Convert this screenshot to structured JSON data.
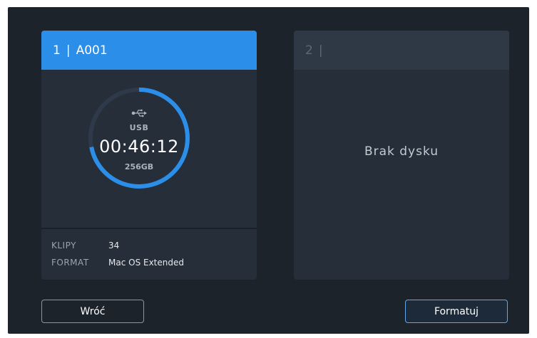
{
  "slot1": {
    "number": "1",
    "separator": "|",
    "name": "A001",
    "media_type": "USB",
    "icon": "usb-icon",
    "remaining_time": "00:46:12",
    "capacity": "256GB",
    "used_fraction": 0.72,
    "details": {
      "clips_label": "KLIPY",
      "clips_value": "34",
      "format_label": "FORMAT",
      "format_value": "Mac OS Extended"
    }
  },
  "slot2": {
    "number": "2",
    "separator": "|",
    "status": "Brak dysku"
  },
  "buttons": {
    "back": "Wróć",
    "format": "Formatuj"
  },
  "colors": {
    "accent": "#2b8ee8",
    "ring_track": "#2e3a49",
    "background": "#1d232b"
  }
}
